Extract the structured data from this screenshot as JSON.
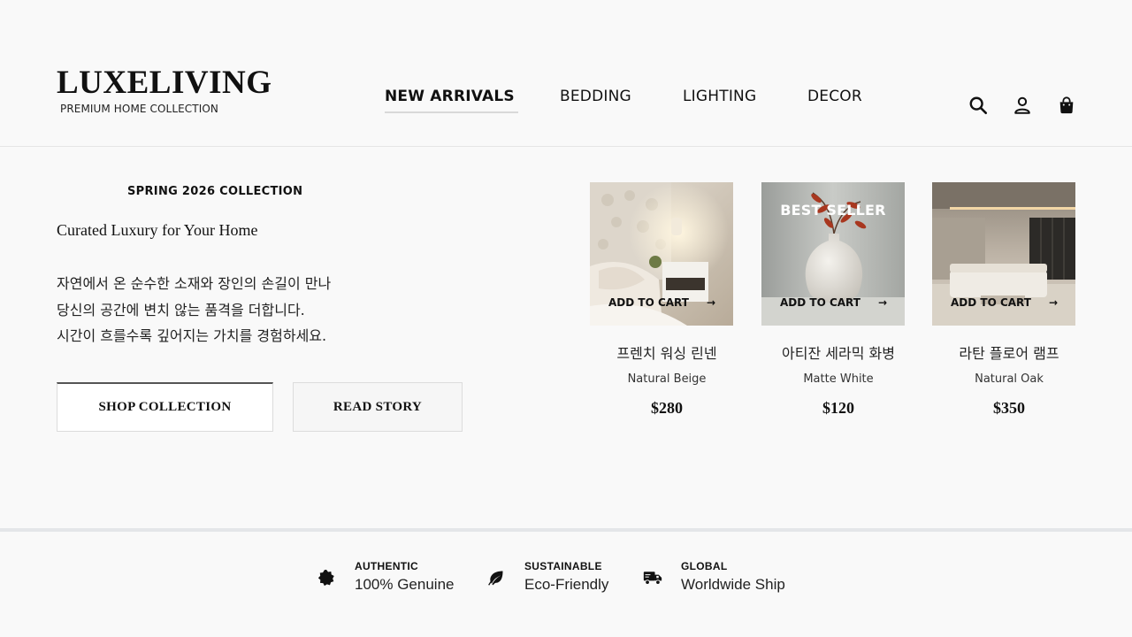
{
  "brand": {
    "name": "LUXELIVING",
    "tagline": "PREMIUM HOME COLLECTION"
  },
  "nav": {
    "items": [
      {
        "label": "NEW ARRIVALS",
        "active": true
      },
      {
        "label": "BEDDING",
        "active": false
      },
      {
        "label": "LIGHTING",
        "active": false
      },
      {
        "label": "DECOR",
        "active": false
      }
    ]
  },
  "header_icons": [
    "search-icon",
    "user-icon",
    "shopping-bag-icon"
  ],
  "hero": {
    "eyebrow": "SPRING 2026 COLLECTION",
    "headline": "Curated Luxury for Your Home",
    "description_lines": [
      "자연에서 온 순수한 소재와 장인의 손길이 만나",
      "당신의 공간에 변치 않는 품격을 더합니다.",
      "시간이 흐를수록 깊어지는 가치를 경험하세요."
    ],
    "primary_button": "SHOP COLLECTION",
    "secondary_button": "READ STORY"
  },
  "products": [
    {
      "name": "프렌치 워싱 린넨",
      "variant": "Natural Beige",
      "price": "$280",
      "add_to_cart": "ADD TO CART",
      "badge": ""
    },
    {
      "name": "아티잔 세라믹 화병",
      "variant": "Matte White",
      "price": "$120",
      "add_to_cart": "ADD TO CART",
      "badge": "BEST SELLER"
    },
    {
      "name": "라탄 플로어 램프",
      "variant": "Natural Oak",
      "price": "$350",
      "add_to_cart": "ADD TO CART",
      "badge": ""
    }
  ],
  "features": [
    {
      "title": "AUTHENTIC",
      "value": "100% Genuine",
      "icon": "badge-check-icon"
    },
    {
      "title": "SUSTAINABLE",
      "value": "Eco-Friendly",
      "icon": "leaf-icon"
    },
    {
      "title": "GLOBAL",
      "value": "Worldwide Ship",
      "icon": "truck-icon"
    }
  ],
  "colors": {
    "background": "#f9f9f9",
    "text": "#111111",
    "divider": "#e4e6e9"
  }
}
